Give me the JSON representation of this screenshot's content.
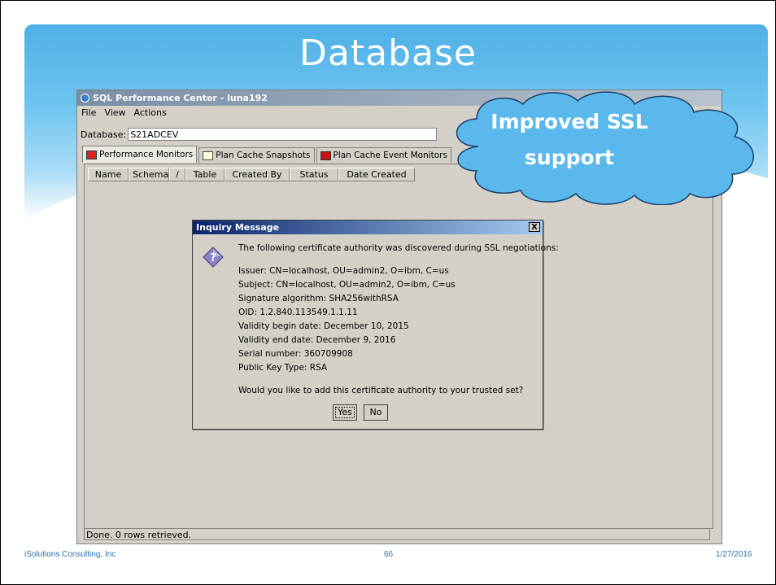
{
  "slide": {
    "title": "Database",
    "footer_left": "iSolutions Consulting, Inc",
    "footer_center": "66",
    "footer_right": "1/27/2016"
  },
  "callout": {
    "line1": "Improved SSL",
    "line2": "support"
  },
  "app": {
    "window_title": "SQL Performance Center - luna192",
    "menu": [
      "File",
      "View",
      "Actions"
    ],
    "database_label": "Database:",
    "database_value": "S21ADCEV",
    "tabs": [
      {
        "label": "Performance Monitors",
        "icon": "performance-monitor-icon"
      },
      {
        "label": "Plan Cache Snapshots",
        "icon": "camera-icon"
      },
      {
        "label": "Plan Cache Event Monitors",
        "icon": "event-monitor-icon"
      }
    ],
    "columns": [
      "Name",
      "Schema",
      "/",
      "Table",
      "Created By",
      "Status",
      "Date Created"
    ],
    "status": "Done. 0 rows retrieved."
  },
  "dialog": {
    "title": "Inquiry Message",
    "close": "X",
    "icon": "question-diamond-icon",
    "intro": "The following certificate authority was discovered during SSL negotiations:",
    "details": [
      "Issuer: CN=localhost, OU=admin2, O=ibm, C=us",
      "Subject: CN=localhost, OU=admin2, O=ibm, C=us",
      "Signature algorithm: SHA256withRSA",
      "OID: 1.2.840.113549.1.1.11",
      "Validity begin date: December 10, 2015",
      "Validity end date: December 9, 2016",
      "Serial number: 360709908",
      "Public Key Type: RSA"
    ],
    "question": "Would you like to add this certificate authority to your trusted set?",
    "yes": "Yes",
    "no": "No"
  }
}
